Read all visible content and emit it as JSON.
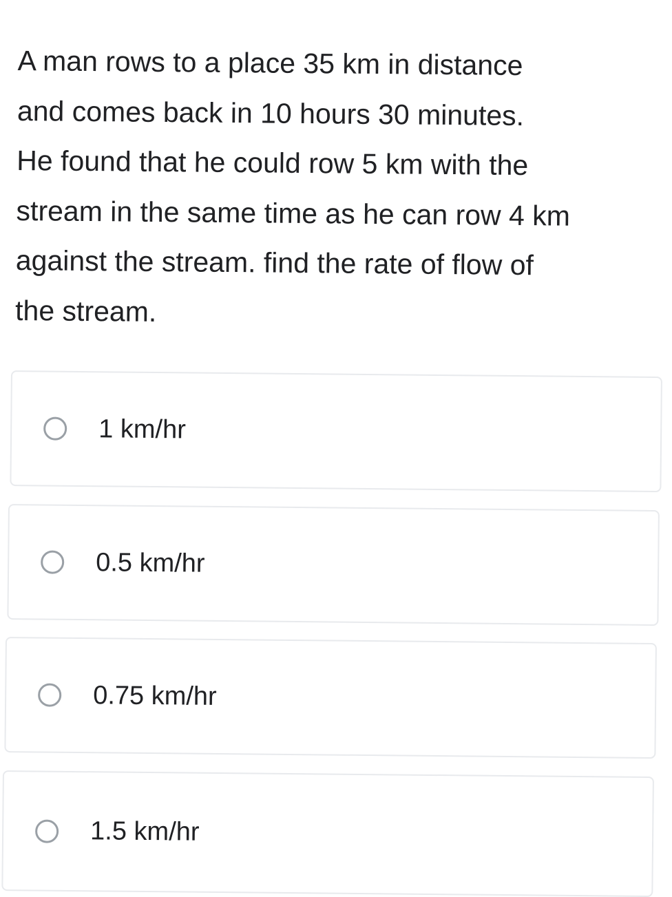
{
  "question": {
    "lines": [
      "A man rows to a place 35 km in distance",
      "and comes back in 10 hours 30 minutes.",
      "He found that he could row 5 km with the",
      "stream in the same time as he can row 4 km",
      "against the stream. find the rate of flow of",
      "the stream."
    ]
  },
  "options": [
    {
      "label": "1 km/hr"
    },
    {
      "label": "0.5 km/hr"
    },
    {
      "label": "0.75 km/hr"
    },
    {
      "label": "1.5 km/hr"
    }
  ],
  "colors": {
    "text": "#202124",
    "radio_border": "#9aa0a6",
    "card_border": "#e8eaed"
  },
  "icons": {
    "radio": "radio-unchecked-icon"
  }
}
